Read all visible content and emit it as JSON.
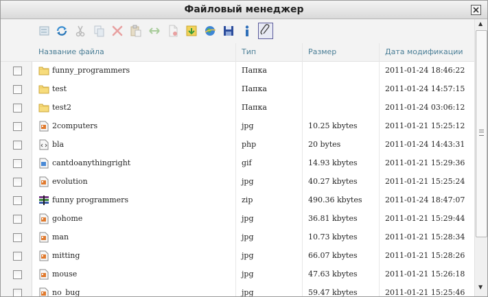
{
  "window": {
    "title": "Файловый менеджер"
  },
  "toolbar": {
    "buttons": [
      "select-all",
      "refresh",
      "cut",
      "copy",
      "delete",
      "paste",
      "move",
      "new-file",
      "upload",
      "web",
      "save",
      "info",
      "edit"
    ],
    "active": "edit"
  },
  "columns": {
    "name": "Название файла",
    "type": "Тип",
    "size": "Размер",
    "date": "Дата модификации"
  },
  "files": [
    {
      "name": "funny_programmers",
      "type": "Папка",
      "size": "",
      "date": "2011-01-24 18:46:22",
      "icon": "folder-icon"
    },
    {
      "name": "test",
      "type": "Папка",
      "size": "",
      "date": "2011-01-24 14:57:15",
      "icon": "folder-icon"
    },
    {
      "name": "test2",
      "type": "Папка",
      "size": "",
      "date": "2011-01-24 03:06:12",
      "icon": "folder-icon"
    },
    {
      "name": "2computers",
      "type": "jpg",
      "size": "10.25 kbytes",
      "date": "2011-01-21 15:25:12",
      "icon": "image-file-icon"
    },
    {
      "name": "bla",
      "type": "php",
      "size": "20 bytes",
      "date": "2011-01-24 14:43:31",
      "icon": "code-file-icon"
    },
    {
      "name": "cantdoanythingright",
      "type": "gif",
      "size": "14.93 kbytes",
      "date": "2011-01-21 15:29:36",
      "icon": "gif-file-icon"
    },
    {
      "name": "evolution",
      "type": "jpg",
      "size": "40.27 kbytes",
      "date": "2011-01-21 15:25:24",
      "icon": "image-file-icon"
    },
    {
      "name": "funny programmers",
      "type": "zip",
      "size": "490.36 kbytes",
      "date": "2011-01-24 18:47:07",
      "icon": "archive-icon"
    },
    {
      "name": "gohome",
      "type": "jpg",
      "size": "36.81 kbytes",
      "date": "2011-01-21 15:29:44",
      "icon": "image-file-icon"
    },
    {
      "name": "man",
      "type": "jpg",
      "size": "10.73 kbytes",
      "date": "2011-01-21 15:28:34",
      "icon": "image-file-icon"
    },
    {
      "name": "mitting",
      "type": "jpg",
      "size": "66.07 kbytes",
      "date": "2011-01-21 15:28:26",
      "icon": "image-file-icon"
    },
    {
      "name": "mouse",
      "type": "jpg",
      "size": "47.63 kbytes",
      "date": "2011-01-21 15:26:18",
      "icon": "image-file-icon"
    },
    {
      "name": "no_bug",
      "type": "jpg",
      "size": "59.47 kbytes",
      "date": "2011-01-21 15:25:46",
      "icon": "image-file-icon"
    }
  ],
  "colors": {
    "header_text": "#4a7e96",
    "panel_bg": "#f3f3f3",
    "accent_blue": "#2f6fb8"
  }
}
